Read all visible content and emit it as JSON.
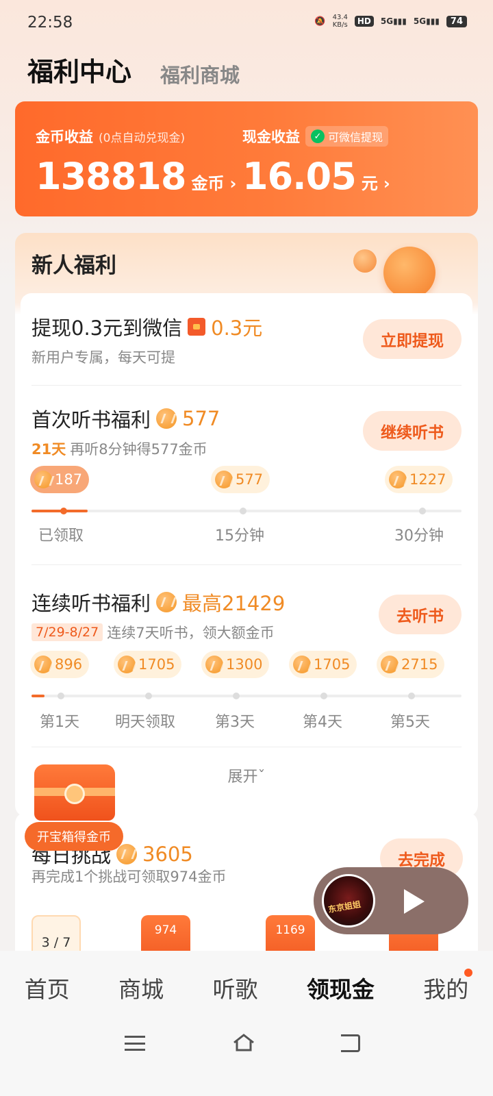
{
  "status_bar": {
    "time": "22:58",
    "net_speed_top": "43.4",
    "net_speed_bottom": "KB/s",
    "hd": "HD",
    "sim_sub": "1",
    "sim_sub2": "2",
    "sig1": "5G",
    "sig2": "5G",
    "battery": "74"
  },
  "top_tabs": {
    "active": "福利中心",
    "inactive": "福利商城"
  },
  "earnings": {
    "coin_title": "金币收益",
    "coin_note": "(0点自动兑现金)",
    "coin_value": "138818",
    "coin_unit": "金币",
    "cash_title": "现金收益",
    "cash_badge": "可微信提现",
    "cash_value": "16.05",
    "cash_unit": "元"
  },
  "newbie": {
    "title": "新人福利",
    "withdraw": {
      "title": "提现0.3元到微信",
      "amount": "0.3元",
      "sub": "新用户专属，每天可提",
      "button": "立即提现"
    },
    "first_listen": {
      "title": "首次听书福利",
      "coins": "577",
      "days": "21天",
      "sub": "再听8分钟得577金币",
      "button": "继续听书",
      "progress": 0.13,
      "milestones": [
        {
          "coins": "187",
          "label": "已领取"
        },
        {
          "coins": "577",
          "label": "15分钟"
        },
        {
          "coins": "1227",
          "label": "30分钟"
        }
      ]
    },
    "streak": {
      "title": "连续听书福利",
      "max": "最高21429",
      "date": "7/29-8/27",
      "sub": "连续7天听书，领大额金币",
      "button": "去听书",
      "progress": 0.03,
      "days": [
        {
          "coins": "896",
          "label": "第1天"
        },
        {
          "coins": "1705",
          "label": "明天领取"
        },
        {
          "coins": "1300",
          "label": "第3天"
        },
        {
          "coins": "1705",
          "label": "第4天"
        },
        {
          "coins": "2715",
          "label": "第5天"
        }
      ]
    },
    "expand": "展开ˇ"
  },
  "chest": {
    "label": "开宝箱得金币"
  },
  "challenge": {
    "title": "每日挑战",
    "coins": "3605",
    "sub": "再完成1个挑战可领取974金币",
    "button": "去完成",
    "current": "3 / 7",
    "steps": [
      "974",
      "1169",
      ""
    ]
  },
  "player": {
    "cover_text": "东京姐姐"
  },
  "bottom_nav": {
    "items": [
      "首页",
      "商城",
      "听歌",
      "领现金",
      "我的"
    ],
    "active": "领现金"
  }
}
